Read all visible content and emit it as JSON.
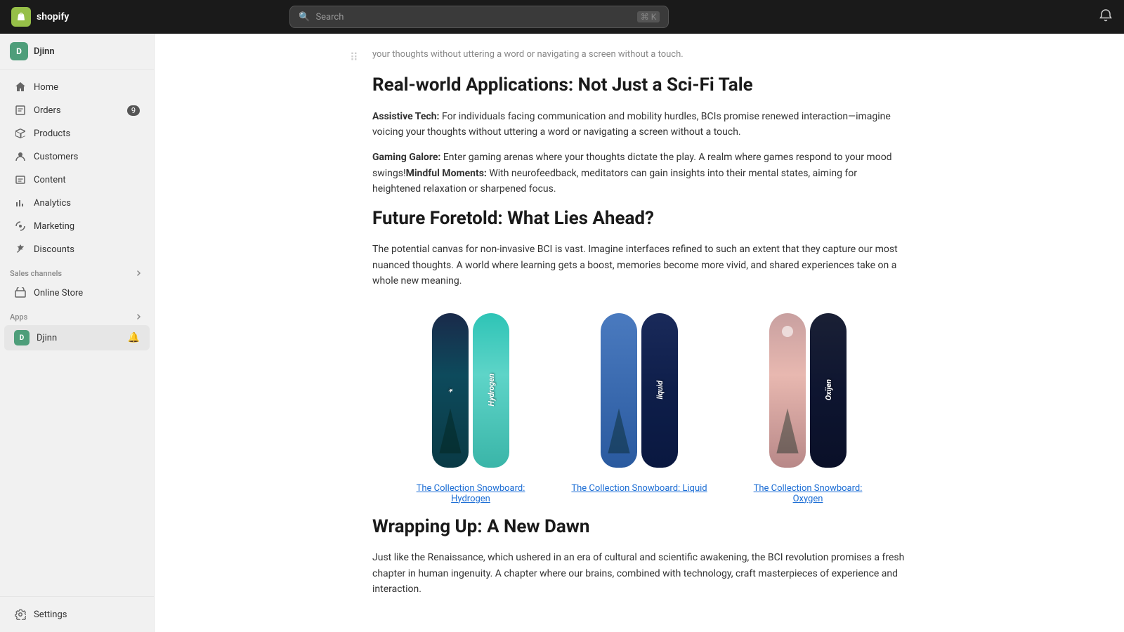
{
  "topbar": {
    "logo_text": "shopify",
    "search_placeholder": "Search",
    "search_shortcut": "⌘ K"
  },
  "sidebar": {
    "store_name": "Djinn",
    "nav_items": [
      {
        "id": "home",
        "label": "Home",
        "icon": "home"
      },
      {
        "id": "orders",
        "label": "Orders",
        "icon": "orders",
        "badge": "9"
      },
      {
        "id": "products",
        "label": "Products",
        "icon": "products"
      },
      {
        "id": "customers",
        "label": "Customers",
        "icon": "customers"
      },
      {
        "id": "content",
        "label": "Content",
        "icon": "content"
      },
      {
        "id": "analytics",
        "label": "Analytics",
        "icon": "analytics"
      },
      {
        "id": "marketing",
        "label": "Marketing",
        "icon": "marketing"
      },
      {
        "id": "discounts",
        "label": "Discounts",
        "icon": "discounts"
      }
    ],
    "sales_channels_label": "Sales channels",
    "online_store_label": "Online Store",
    "apps_label": "Apps",
    "djinn_app_label": "Djinn",
    "settings_label": "Settings"
  },
  "article": {
    "top_text": "your thoughts without uttering a word or navigating a screen without a touch.",
    "section1_heading": "Real-world Applications: Not Just a Sci-Fi Tale",
    "assistive_tech_title": "Assistive Tech:",
    "assistive_tech_text": " For individuals facing communication and mobility hurdles, BCIs promise renewed interaction—imagine voicing your thoughts without uttering a word or navigating a screen without a touch.",
    "gaming_title": "Gaming Galore:",
    "gaming_text": " Enter gaming arenas where your thoughts dictate the play. A realm where games respond to your mood swings!",
    "mindful_title": "Mindful Moments:",
    "mindful_text": " With neurofeedback, meditators can gain insights into their mental states, aiming for heightened relaxation or sharpened focus.",
    "section2_heading": "Future Foretold: What Lies Ahead?",
    "future_text": "The potential canvas for non-invasive BCI is vast. Imagine interfaces refined to such an extent that they capture our most nuanced thoughts. A world where learning gets a boost, memories become more vivid, and shared experiences take on a whole new meaning.",
    "section3_heading": "Wrapping Up: A New Dawn",
    "wrapping_text": "Just like the Renaissance, which ushered in an era of cultural and scientific awakening, the BCI revolution promises a fresh chapter in human ingenuity. A chapter where our brains, combined with technology, craft masterpieces of experience and interaction.",
    "products": [
      {
        "id": "hydrogen",
        "link_text": "The Collection Snowboard: Hydrogen",
        "color1": "#1a3a5c",
        "color2": "#2ec4b6"
      },
      {
        "id": "liquid",
        "link_text": "The Collection Snowboard: Liquid",
        "color1": "#4a7abf",
        "color2": "#1a2a5a"
      },
      {
        "id": "oxygen",
        "link_text": "The Collection Snowboard: Oxygen",
        "color1": "#c8a0a0",
        "color2": "#1a2035"
      }
    ]
  }
}
